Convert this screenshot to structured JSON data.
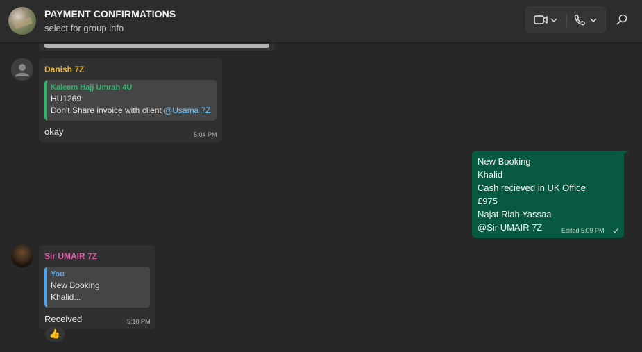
{
  "header": {
    "title": "PAYMENT CONFIRMATIONS",
    "subtitle": "select for group info"
  },
  "colors": {
    "background": "#272727",
    "header_bg": "#2c2c2c",
    "incoming_bubble": "#303030",
    "outgoing_bubble": "#085941",
    "quote_bg": "#454545",
    "mention": "#6cc6ff",
    "danish_name": "#e8b53a",
    "kaleem_name": "#2fb36b",
    "umair_name": "#e05ba8",
    "you_name": "#53a3f2"
  },
  "messages": [
    {
      "sender": "Danish 7Z",
      "quote": {
        "author": "Kaleem Hajj Umrah 4U",
        "line1": "HU1269",
        "line2_text": "Don't Share invoice with client ",
        "line2_mention": "@Usama 7Z"
      },
      "text": "okay",
      "time": "5:04 PM"
    },
    {
      "outgoing": true,
      "lines": [
        "New Booking",
        "Khalid",
        "Cash recieved in UK Office",
        "£975",
        "Najat Riah Yassaa"
      ],
      "mention": "@Sir UMAIR 7Z",
      "time": "Edited 5:09 PM",
      "status_icon": "check-icon"
    },
    {
      "sender": "Sir UMAIR 7Z",
      "quote": {
        "author": "You",
        "line1": "New Booking",
        "line2": "Khalid..."
      },
      "text": "Received",
      "time": "5:10 PM",
      "reaction": "👍"
    }
  ]
}
